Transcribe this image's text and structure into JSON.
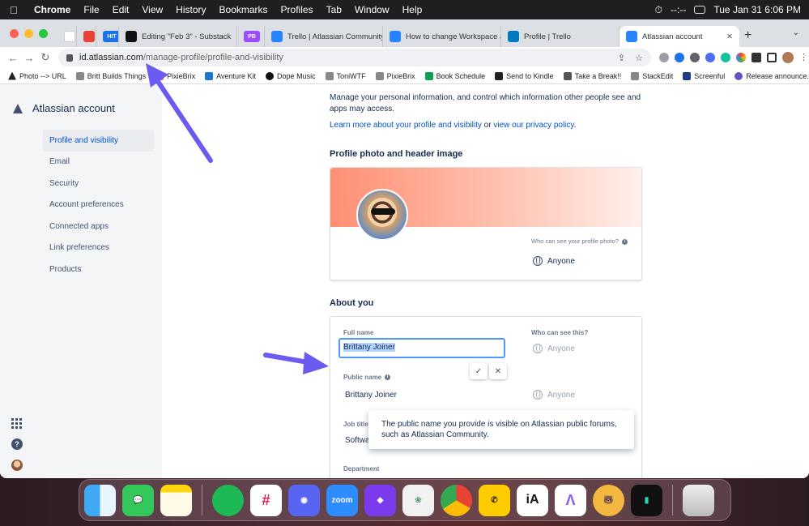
{
  "menubar": {
    "app": "Chrome",
    "items": [
      "File",
      "Edit",
      "View",
      "History",
      "Bookmarks",
      "Profiles",
      "Tab",
      "Window",
      "Help"
    ],
    "timer": "--:--",
    "clock": "Tue Jan 31  6:06 PM"
  },
  "tabs": [
    {
      "label": "",
      "fav_text": "",
      "color": "#e8eaed"
    },
    {
      "label": "",
      "fav_text": "",
      "color": "#e8eaed"
    },
    {
      "label": "",
      "fav_text": "HIT",
      "color": "#1a73e8"
    },
    {
      "label": "Editing \"Feb 3\" - Substack",
      "fav_text": "",
      "color": "#111111"
    },
    {
      "label": "",
      "fav_text": "PB",
      "color": "#9b4dff"
    },
    {
      "label": "Trello | Atlassian Community",
      "fav_text": "",
      "color": "#2684ff"
    },
    {
      "label": "How to change Workspace a",
      "fav_text": "",
      "color": "#2684ff"
    },
    {
      "label": "Profile | Trello",
      "fav_text": "",
      "color": "#0079bf"
    },
    {
      "label": "Atlassian account",
      "fav_text": "",
      "color": "#2684ff"
    }
  ],
  "url": {
    "host": "id.atlassian.com",
    "path": "/manage-profile/profile-and-visibility"
  },
  "bookmarks": [
    "Photo --> URL",
    "Britt Builds Things",
    "PixieBrix",
    "Aventure Kit",
    "Dope Music",
    "ToniWTF",
    "PixieBrix",
    "Book Schedule",
    "Send to Kindle",
    "Take a Break!!",
    "StackEdit",
    "Screenful",
    "Release announce..."
  ],
  "sidebar": {
    "title": "Atlassian account",
    "items": [
      "Profile and visibility",
      "Email",
      "Security",
      "Account preferences",
      "Connected apps",
      "Link preferences",
      "Products"
    ]
  },
  "main": {
    "intro": "Manage your personal information, and control which information other people see and apps may access.",
    "learn_link": "Learn more about your profile and visibility",
    "or": "or",
    "privacy_link": "view our privacy policy",
    "period": ".",
    "photo_section": "Profile photo and header image",
    "photo_who": "Who can see your profile photo?",
    "photo_visibility": "Anyone",
    "about_section": "About you",
    "who_can_see": "Who can see this?",
    "full_name_label": "Full name",
    "full_name_value": "Brittany Joiner",
    "full_name_visibility": "Anyone",
    "public_name_label": "Public name",
    "public_name_value": "Brittany Joiner",
    "public_name_visibility": "Anyone",
    "job_title_label": "Job title",
    "job_title_value": "Softwa",
    "department_label": "Department",
    "tooltip": "The public name you provide is visible on Atlassian public forums, such as Atlassian Community.",
    "confirm_symbol": "✓",
    "cancel_symbol": "✕"
  },
  "annotation_color": "#6b5bf0",
  "dock": [
    "Finder",
    "Messages",
    "Notes",
    "Spotify",
    "Slack",
    "Discord",
    "zoom",
    "Obsidian",
    "Lotus",
    "Chrome",
    "WhatsApp",
    "iA",
    "Linear",
    "Bear",
    "Streaks",
    "Trash"
  ]
}
